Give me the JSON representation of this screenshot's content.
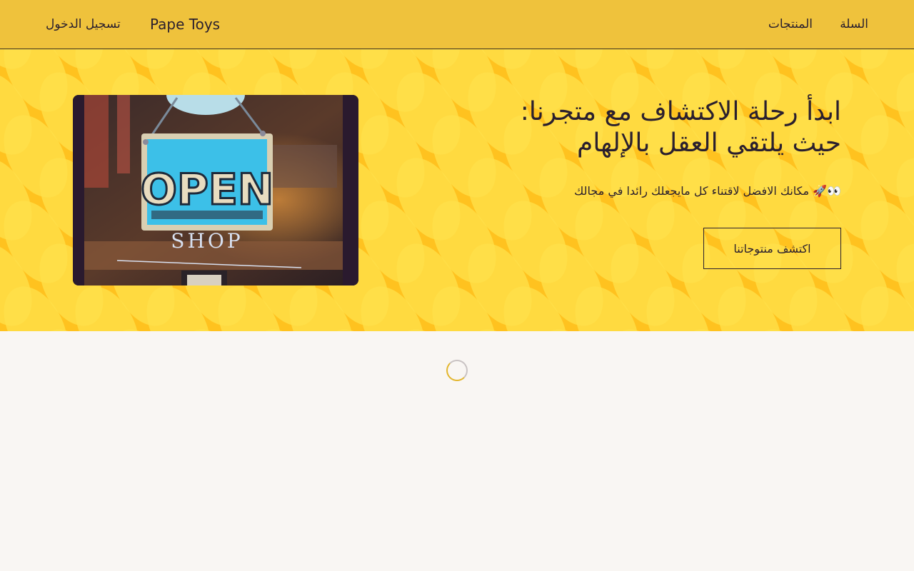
{
  "nav": {
    "cart": "السلة",
    "products": "المنتجات",
    "brand": "Pape Toys",
    "login": "تسجيل الدخول"
  },
  "hero": {
    "title_line1": "ابدأ رحلة الاكتشاف مع متجرنا:",
    "title_line2": "حيث يلتقي العقل بالإلهام",
    "subtitle": "👀🚀 مكانك الافضل لاقتناء كل مايجعلك رائدا في مجالك",
    "cta_label": "اكتشف منتوجاتنا",
    "image_sign_word": "OPEN",
    "image_sign_caption": "SHOP"
  },
  "colors": {
    "navbar": "#efc23c",
    "hero_background": "#ffc21f",
    "page_background": "#f9f6f3",
    "text": "#2a1f2e",
    "spinner_accent": "#e3b62e"
  },
  "icons": {
    "loading": "loading-spinner-icon"
  }
}
